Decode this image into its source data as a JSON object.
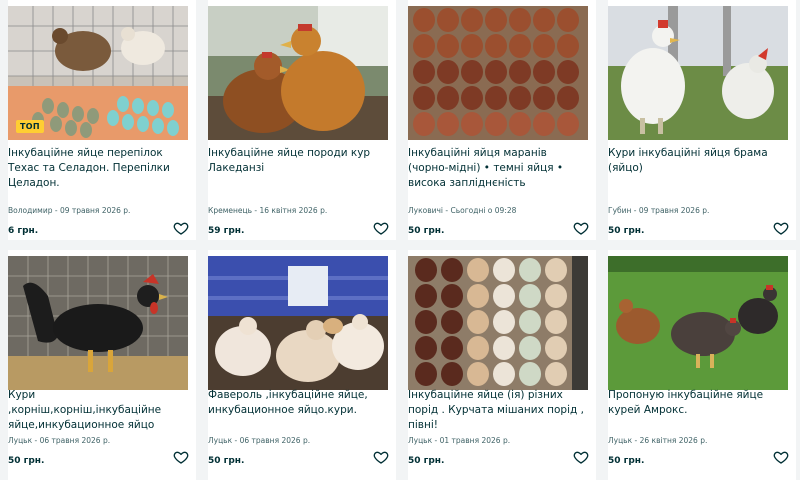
{
  "listings": [
    {
      "title": "Інкубаційне яйце перепілок Техас та Селадон. Перепілки Целадон.",
      "meta": "Володимир - 09 травня 2026 р.",
      "price": "6 грн.",
      "badge": "ТОП",
      "photo_icon": "quail-eggs-photo"
    },
    {
      "title": "Інкубаційне яйце породи кур Лакеданзі",
      "meta": "Кременець - 16 квітня 2026 р.",
      "price": "59 грн.",
      "photo_icon": "hens-photo"
    },
    {
      "title": "Інкубаційні яйця маранів (чорно-мідні) • темні яйця • висока запліднєність",
      "meta": "Луковичі - Сьогодні о 09:28",
      "price": "50 грн.",
      "photo_icon": "brown-eggs-tray-photo"
    },
    {
      "title": "Кури інкубаційні яйця брама (яйцо)",
      "meta": "Губин - 09 травня 2026 р.",
      "price": "50 грн.",
      "photo_icon": "white-chickens-photo"
    },
    {
      "title": "Кури ,корніш,корніш,інкубаційне яйце,инкубационное яйцо",
      "meta": "Луцьк - 06 травня 2026 р.",
      "price": "50 грн.",
      "photo_icon": "black-rooster-photo"
    },
    {
      "title": "Фавероль ,інкубаційне яйце, инкубационное яйцо.кури.",
      "meta": "Луцьк - 06 травня 2026 р.",
      "price": "50 грн.",
      "photo_icon": "faverolles-photo"
    },
    {
      "title": "Інкубаційне яйце (ія) різних порід . Курчата мішаних порід , півні!",
      "meta": "Луцьк - 01 травня 2026 р.",
      "price": "50 грн.",
      "photo_icon": "mixed-eggs-tray-photo"
    },
    {
      "title": "Пропоную інкубаційне яйце курей Амрокс.",
      "meta": "Луцьк - 26 квітня 2026 р.",
      "price": "50 грн.",
      "photo_icon": "hens-on-grass-photo"
    }
  ],
  "icons": {
    "favorite": "heart-outline-icon"
  },
  "colors": {
    "text": "#002f34",
    "meta": "#406367",
    "badge": "#ffce32",
    "background": "#f2f4f5"
  }
}
